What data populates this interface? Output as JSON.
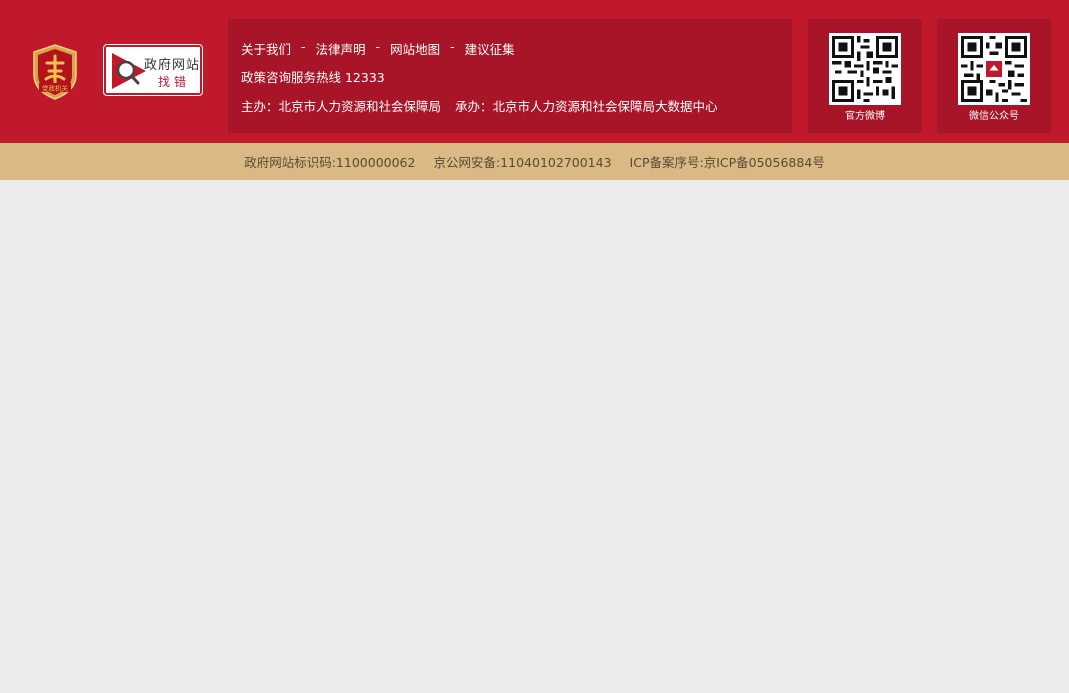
{
  "badge": {
    "text": "党政机关",
    "icon": "party-government-badge-icon"
  },
  "jiucuo": {
    "line1": "政府网站",
    "line2": "找错",
    "icon": "magnifier-icon"
  },
  "links": [
    {
      "label": "关于我们"
    },
    {
      "label": "法律声明"
    },
    {
      "label": "网站地图"
    },
    {
      "label": "建议征集"
    }
  ],
  "separator": "-",
  "hotline": "政策咨询服务热线 12333",
  "sponsor": {
    "host": "主办：北京市人力资源和社会保障局",
    "organizer": "承办：北京市人力资源和社会保障局大数据中心"
  },
  "qr": {
    "weibo_caption": "官方微博",
    "wechat_caption": "微信公众号"
  },
  "footer": {
    "site_id": "政府网站标识码:1100000062",
    "police": "京公网安备:11040102700143",
    "icp": "ICP备案序号:京ICP备05056884号"
  },
  "colors": {
    "primary_red": "#c0192c",
    "panel_red": "#a81528",
    "gold_bar": "#dbb985",
    "body_bg": "#ebebeb"
  }
}
